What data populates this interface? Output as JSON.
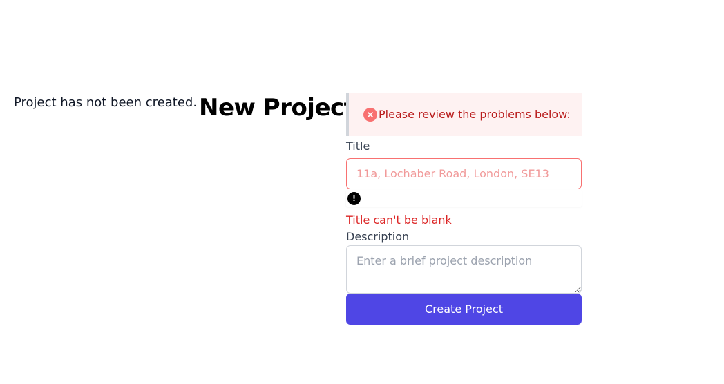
{
  "flash": {
    "notice": "Project has not been created."
  },
  "page": {
    "title": "New Project"
  },
  "form": {
    "error_summary": {
      "icon": "x-circle-icon",
      "message": "Please review the problems below:"
    },
    "title_field": {
      "label": "Title",
      "value": "",
      "placeholder": "11a, Lochaber Road, London, SE13",
      "feedback_icon": "exclamation-icon",
      "feedback_icon_glyph": "!",
      "error": "Title can't be blank"
    },
    "description_field": {
      "label": "Description",
      "value": "",
      "placeholder": "Enter a brief project description"
    },
    "submit": {
      "label": "Create Project"
    }
  },
  "colors": {
    "accent": "#4f46e5",
    "error": "#dc2626",
    "error_background": "#fef2f2",
    "error_icon": "#f87171"
  }
}
